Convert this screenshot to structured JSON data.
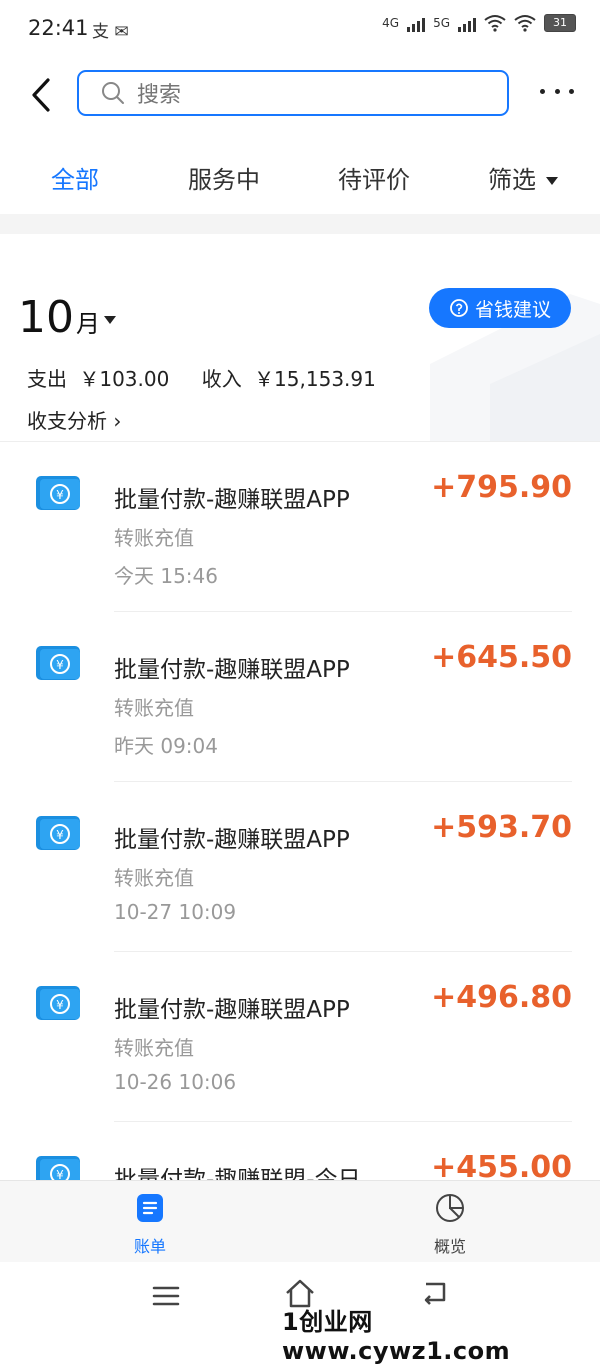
{
  "status_bar": {
    "time": "22:41",
    "app_icons": "支 ✉",
    "network_1": "4G",
    "network_2": "5G",
    "battery": "31"
  },
  "search": {
    "placeholder": "搜索"
  },
  "tabs": [
    {
      "label": "全部",
      "active": true
    },
    {
      "label": "服务中"
    },
    {
      "label": "待评价"
    },
    {
      "label": "筛选"
    }
  ],
  "summary": {
    "month_number": "10",
    "month_suffix": "月",
    "save_button_label": "省钱建议",
    "expense_label": "支出",
    "expense_value": "￥103.00",
    "income_label": "收入",
    "income_value": "￥15,153.91",
    "analysis_label": "收支分析 ›"
  },
  "transactions": [
    {
      "title": "批量付款-趣赚联盟APP",
      "amount": "+795.90",
      "category": "转账充值",
      "time": "今天  15:46"
    },
    {
      "title": "批量付款-趣赚联盟APP",
      "amount": "+645.50",
      "category": "转账充值",
      "time": "昨天  09:04"
    },
    {
      "title": "批量付款-趣赚联盟APP",
      "amount": "+593.70",
      "category": "转账充值",
      "time": "10-27  10:09"
    },
    {
      "title": "批量付款-趣赚联盟APP",
      "amount": "+496.80",
      "category": "转账充值",
      "time": "10-26  10:06"
    },
    {
      "title": "批量付款-趣赚联盟-今日…",
      "amount": "+455.00",
      "category": "",
      "time": ""
    }
  ],
  "bottom_nav": [
    {
      "label": "账单",
      "active": true
    },
    {
      "label": "概览"
    }
  ],
  "watermark": "1创业网www.cywz1.com",
  "colors": {
    "accent": "#1677ff",
    "amount": "#e8612c",
    "muted": "#999999"
  }
}
